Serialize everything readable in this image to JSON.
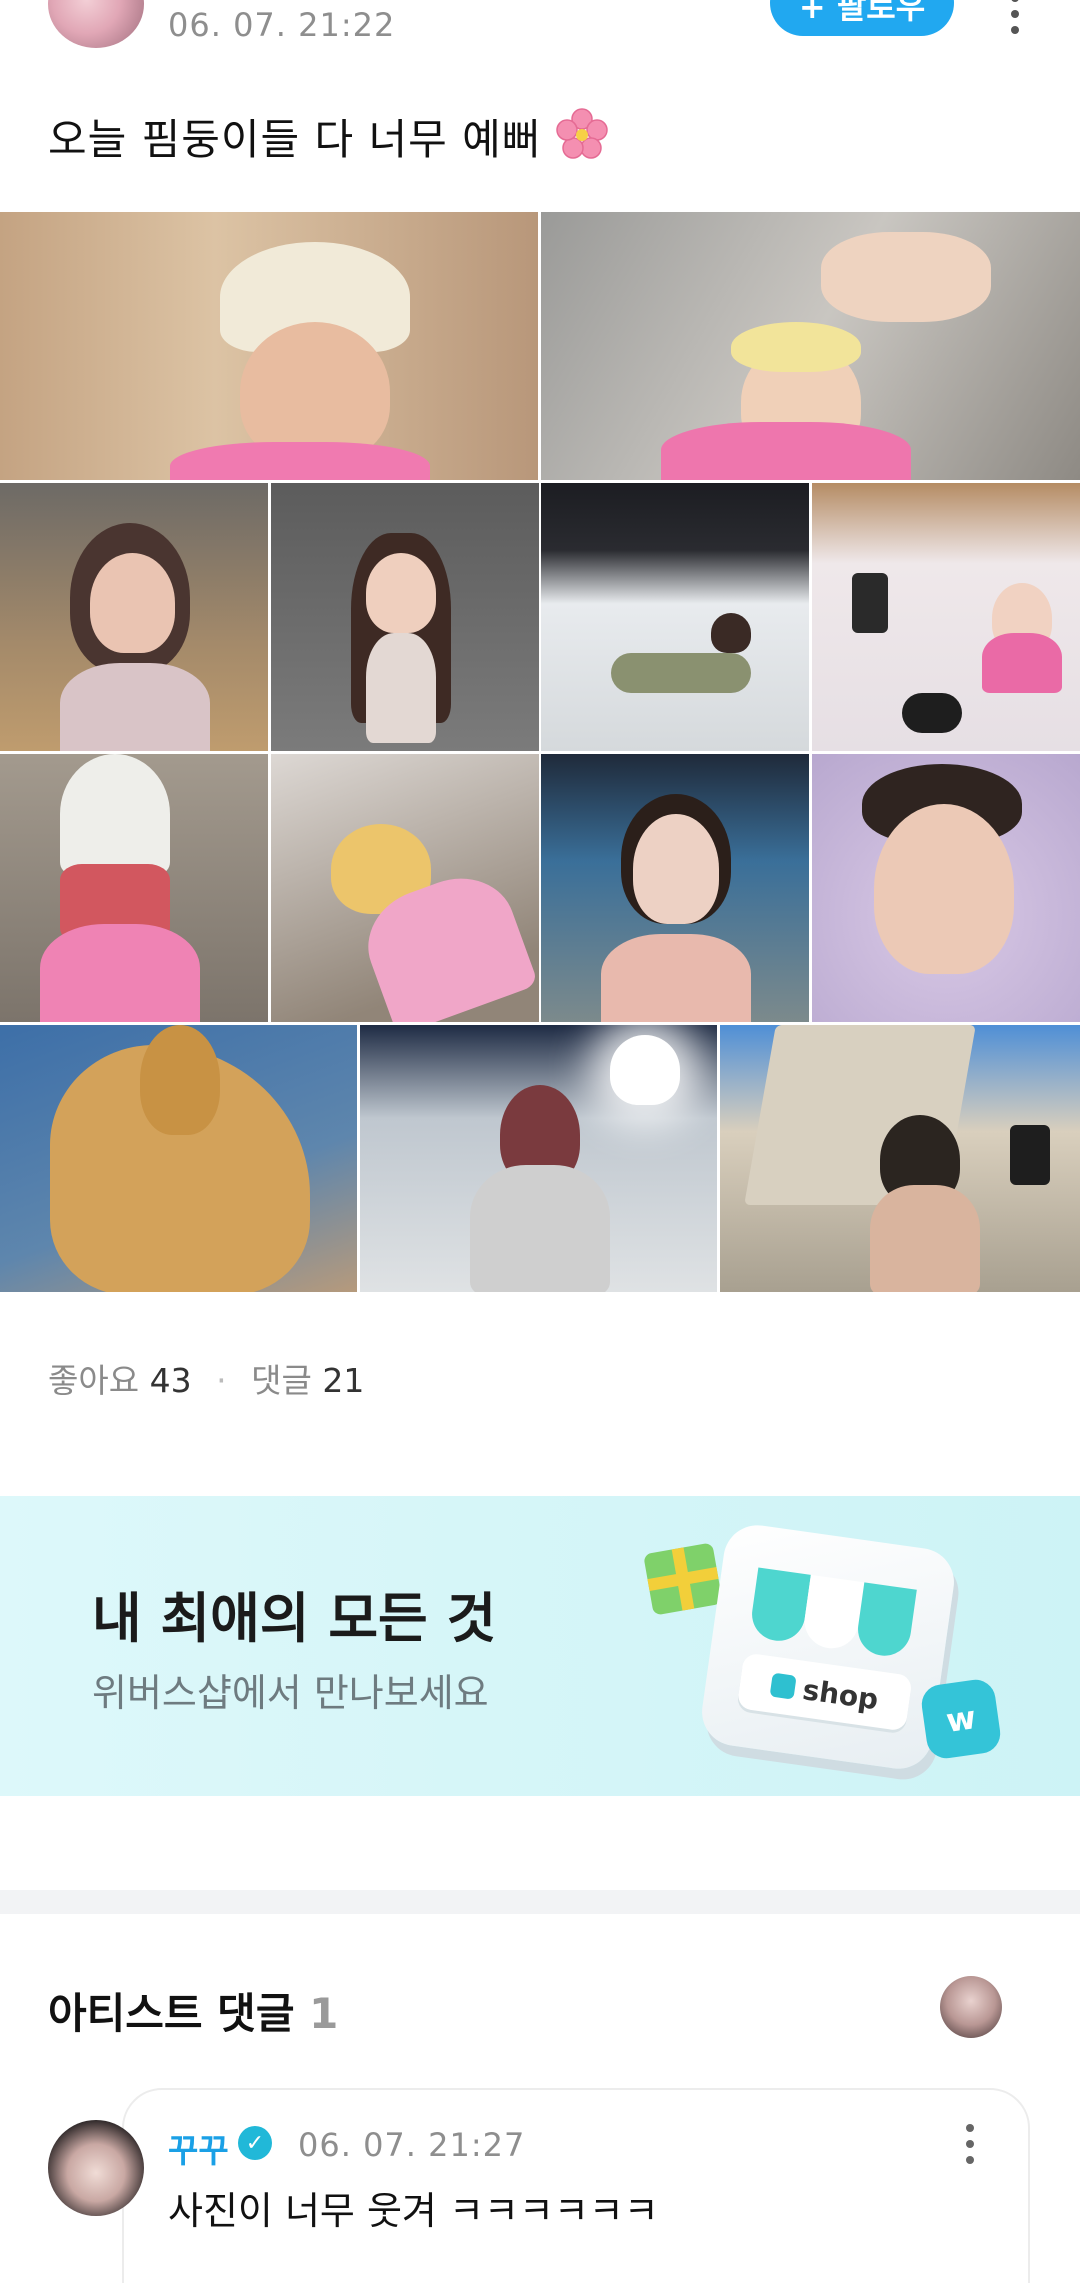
{
  "post": {
    "timestamp": "06. 07. 21:22",
    "follow_label": "+ 팔로우",
    "text": "오늘 핌둥이들 다 너무 예뻐"
  },
  "stats": {
    "likes_label": "좋아요",
    "likes_count": "43",
    "comments_label": "댓글",
    "comments_count": "21"
  },
  "banner": {
    "title": "내 최애의 모든 것",
    "subtitle": "위버스샵에서 만나보세요",
    "shop_label": "shop",
    "bag_letter": "w"
  },
  "artist_comments": {
    "title": "아티스트 댓글",
    "count": "1",
    "comment": {
      "author": "꾸꾸",
      "timestamp": "06. 07. 21:27",
      "text": "사진이 너무 웃겨 ㅋㅋㅋㅋㅋㅋ"
    }
  },
  "colors": {
    "accent": "#21a8f0",
    "banner_bg": "#d6f6f8",
    "teal": "#34c4d8"
  },
  "icons": [
    "more-vertical-icon",
    "cherry-blossom-icon",
    "verified-badge-icon",
    "gift-icon",
    "shop-bag-icon"
  ]
}
